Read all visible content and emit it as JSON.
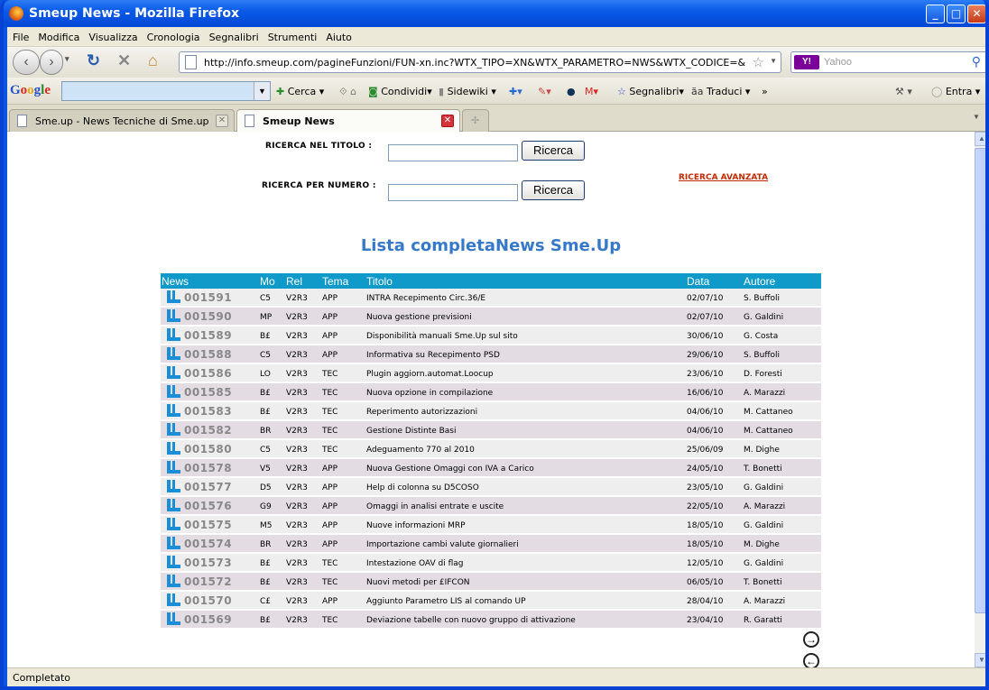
{
  "window": {
    "title": "Smeup News - Mozilla Firefox"
  },
  "menu": [
    "File",
    "Modifica",
    "Visualizza",
    "Cronologia",
    "Segnalibri",
    "Strumenti",
    "Aiuto"
  ],
  "nav": {
    "url": "http://info.smeup.com/pagineFunzioni/FUN-xn.inc?WTX_TIPO=XN&WTX_PARAMETRO=NWS&WTX_CODICE=&WTX_TIPOFU",
    "search_placeholder": "Yahoo",
    "search_engine": "Y!"
  },
  "google_toolbar": {
    "logo": "Google",
    "items": [
      "Cerca",
      "Condividi",
      "Sidewiki",
      "Segnalibri",
      "Traduci",
      "»",
      "Entra"
    ]
  },
  "tabs": [
    {
      "label": "Sme.up - News Tecniche di Sme.up",
      "active": false
    },
    {
      "label": "Smeup News",
      "active": true
    }
  ],
  "form": {
    "title_label": "RICERCA NEL TITOLO :",
    "number_label": "RICERCA PER NUMERO :",
    "button_label": "Ricerca",
    "advanced_link": "RICERCA AVANZATA"
  },
  "page_title": "Lista completaNews Sme.Up",
  "table": {
    "headers": {
      "news": "News",
      "mo": "Mo",
      "rel": "Rel",
      "tema": "Tema",
      "titolo": "Titolo",
      "data": "Data",
      "autore": "Autore"
    },
    "rows": [
      {
        "num": "001591",
        "mo": "C5",
        "rel": "V2R3",
        "tema": "APP",
        "titolo": "INTRA Recepimento Circ.36/E",
        "data": "02/07/10",
        "autore": "S. Buffoli"
      },
      {
        "num": "001590",
        "mo": "MP",
        "rel": "V2R3",
        "tema": "APP",
        "titolo": "Nuova gestione previsioni",
        "data": "02/07/10",
        "autore": "G. Galdini"
      },
      {
        "num": "001589",
        "mo": "B£",
        "rel": "V2R3",
        "tema": "APP",
        "titolo": "Disponibilità manuali Sme.Up sul sito",
        "data": "30/06/10",
        "autore": "G. Costa"
      },
      {
        "num": "001588",
        "mo": "C5",
        "rel": "V2R3",
        "tema": "APP",
        "titolo": "Informativa su Recepimento PSD",
        "data": "29/06/10",
        "autore": "S. Buffoli"
      },
      {
        "num": "001586",
        "mo": "LO",
        "rel": "V2R3",
        "tema": "TEC",
        "titolo": "Plugin aggiorn.automat.Loocup",
        "data": "23/06/10",
        "autore": "D. Foresti"
      },
      {
        "num": "001585",
        "mo": "B£",
        "rel": "V2R3",
        "tema": "TEC",
        "titolo": "Nuova opzione in compilazione",
        "data": "16/06/10",
        "autore": "A. Marazzi"
      },
      {
        "num": "001583",
        "mo": "B£",
        "rel": "V2R3",
        "tema": "TEC",
        "titolo": "Reperimento autorizzazioni",
        "data": "04/06/10",
        "autore": "M. Cattaneo"
      },
      {
        "num": "001582",
        "mo": "BR",
        "rel": "V2R3",
        "tema": "TEC",
        "titolo": "Gestione Distinte Basi",
        "data": "04/06/10",
        "autore": "M. Cattaneo"
      },
      {
        "num": "001580",
        "mo": "C5",
        "rel": "V2R3",
        "tema": "TEC",
        "titolo": "Adeguamento 770 al 2010",
        "data": "25/06/09",
        "autore": "M. Dighe"
      },
      {
        "num": "001578",
        "mo": "V5",
        "rel": "V2R3",
        "tema": "APP",
        "titolo": "Nuova Gestione Omaggi con IVA a Carico",
        "data": "24/05/10",
        "autore": "T. Bonetti"
      },
      {
        "num": "001577",
        "mo": "D5",
        "rel": "V2R3",
        "tema": "APP",
        "titolo": "Help di colonna su D5COSO",
        "data": "23/05/10",
        "autore": "G. Galdini"
      },
      {
        "num": "001576",
        "mo": "G9",
        "rel": "V2R3",
        "tema": "APP",
        "titolo": "Omaggi in analisi entrate e uscite",
        "data": "22/05/10",
        "autore": "A. Marazzi"
      },
      {
        "num": "001575",
        "mo": "M5",
        "rel": "V2R3",
        "tema": "APP",
        "titolo": "Nuove informazioni MRP",
        "data": "18/05/10",
        "autore": "G. Galdini"
      },
      {
        "num": "001574",
        "mo": "BR",
        "rel": "V2R3",
        "tema": "APP",
        "titolo": "Importazione cambi valute giornalieri",
        "data": "18/05/10",
        "autore": "M. Dighe"
      },
      {
        "num": "001573",
        "mo": "B£",
        "rel": "V2R3",
        "tema": "TEC",
        "titolo": "Intestazione OAV di flag",
        "data": "12/05/10",
        "autore": "G. Galdini"
      },
      {
        "num": "001572",
        "mo": "B£",
        "rel": "V2R3",
        "tema": "TEC",
        "titolo": "Nuovi metodi per £IFCON",
        "data": "06/05/10",
        "autore": "T. Bonetti"
      },
      {
        "num": "001570",
        "mo": "C£",
        "rel": "V2R3",
        "tema": "APP",
        "titolo": "Aggiunto Parametro LIS al comando UP",
        "data": "28/04/10",
        "autore": "A. Marazzi"
      },
      {
        "num": "001569",
        "mo": "B£",
        "rel": "V2R3",
        "tema": "TEC",
        "titolo": "Deviazione tabelle con nuovo gruppo di attivazione",
        "data": "23/04/10",
        "autore": "R. Garatti"
      }
    ]
  },
  "status": "Completato"
}
